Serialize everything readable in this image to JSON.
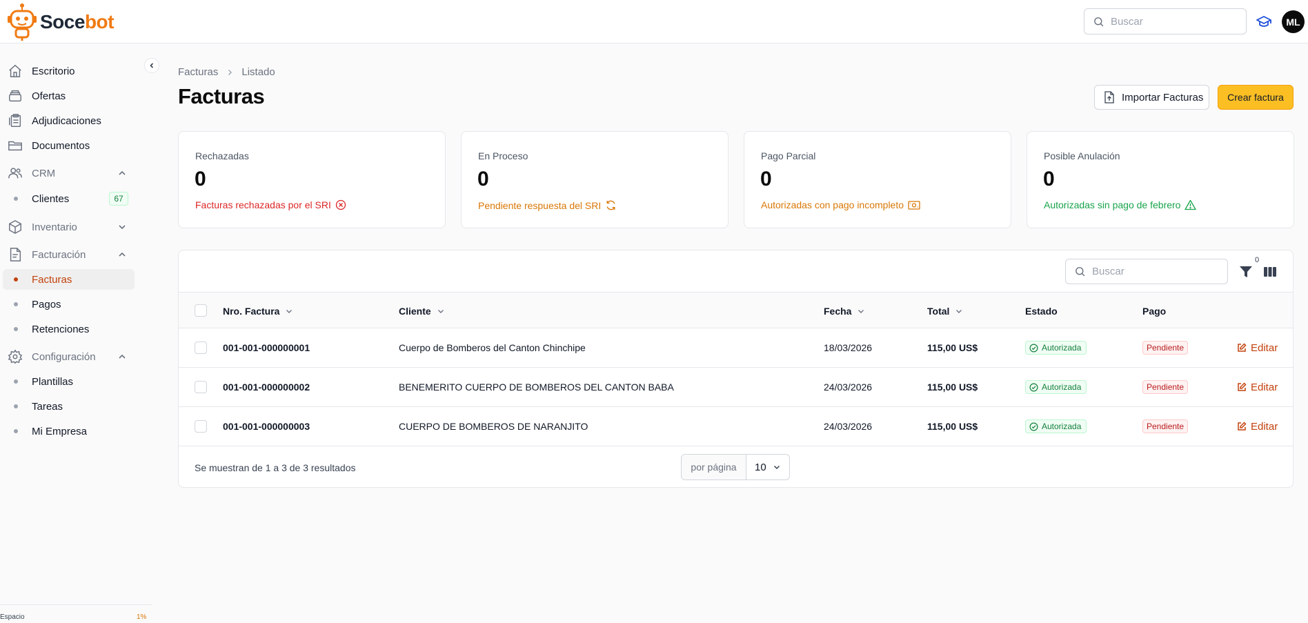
{
  "app": {
    "logo_part1": "Soce",
    "logo_part2": "bot",
    "brand_color": "#f07b13",
    "accent_color": "#fbbf24"
  },
  "header": {
    "search_placeholder": "Buscar",
    "avatar_initials": "ML",
    "cap_icon": "graduation-cap-icon"
  },
  "sidebar": {
    "items": [
      {
        "label": "Escritorio",
        "icon": "home-icon"
      },
      {
        "label": "Ofertas",
        "icon": "layers-icon"
      },
      {
        "label": "Adjudicaciones",
        "icon": "clipboard-icon"
      },
      {
        "label": "Documentos",
        "icon": "folder-icon"
      }
    ],
    "groups": [
      {
        "label": "CRM",
        "icon": "users-icon",
        "expanded": true,
        "children": [
          {
            "label": "Clientes",
            "badge": "67"
          }
        ]
      },
      {
        "label": "Inventario",
        "icon": "box-icon",
        "expanded": false,
        "children": []
      },
      {
        "label": "Facturación",
        "icon": "invoice-icon",
        "expanded": true,
        "children": [
          {
            "label": "Facturas",
            "active": true
          },
          {
            "label": "Pagos"
          },
          {
            "label": "Retenciones"
          }
        ]
      },
      {
        "label": "Configuración",
        "icon": "gear-icon",
        "expanded": true,
        "children": [
          {
            "label": "Plantillas"
          },
          {
            "label": "Tareas"
          },
          {
            "label": "Mi Empresa"
          }
        ]
      }
    ],
    "space_label": "Espacio",
    "space_percent": "1%"
  },
  "breadcrumb": [
    "Facturas",
    "Listado"
  ],
  "page_title": "Facturas",
  "actions": {
    "import_label": "Importar Facturas",
    "create_label": "Crear factura"
  },
  "stats": [
    {
      "title": "Rechazadas",
      "value": "0",
      "desc": "Facturas rechazadas por el SRI",
      "color": "#dc2626",
      "icon": "x-circle-icon"
    },
    {
      "title": "En Proceso",
      "value": "0",
      "desc": "Pendiente respuesta del SRI",
      "color": "#d97706",
      "icon": "refresh-icon"
    },
    {
      "title": "Pago Parcial",
      "value": "0",
      "desc": "Autorizadas con pago incompleto",
      "color": "#d97706",
      "icon": "money-icon"
    },
    {
      "title": "Posible Anulación",
      "value": "0",
      "desc": "Autorizadas sin pago de febrero",
      "color": "#16a34a",
      "icon": "warning-triangle-icon"
    }
  ],
  "table": {
    "search_placeholder": "Buscar",
    "filter_count": "0",
    "columns": [
      "Nro. Factura",
      "Cliente",
      "Fecha",
      "Total",
      "Estado",
      "Pago"
    ],
    "rows": [
      {
        "numero": "001-001-000000001",
        "cliente": "Cuerpo de Bomberos del Canton Chinchipe",
        "fecha": "18/03/2026",
        "total": "115,00 US$",
        "estado": "Autorizada",
        "pago": "Pendiente",
        "accion": "Editar"
      },
      {
        "numero": "001-001-000000002",
        "cliente": "BENEMERITO CUERPO DE BOMBEROS DEL CANTON BABA",
        "fecha": "24/03/2026",
        "total": "115,00 US$",
        "estado": "Autorizada",
        "pago": "Pendiente",
        "accion": "Editar"
      },
      {
        "numero": "001-001-000000003",
        "cliente": "CUERPO DE BOMBEROS DE NARANJITO",
        "fecha": "24/03/2026",
        "total": "115,00 US$",
        "estado": "Autorizada",
        "pago": "Pendiente",
        "accion": "Editar"
      }
    ],
    "results_text": "Se muestran de 1 a 3 de 3 resultados",
    "per_page_label": "por página",
    "per_page_value": "10"
  }
}
